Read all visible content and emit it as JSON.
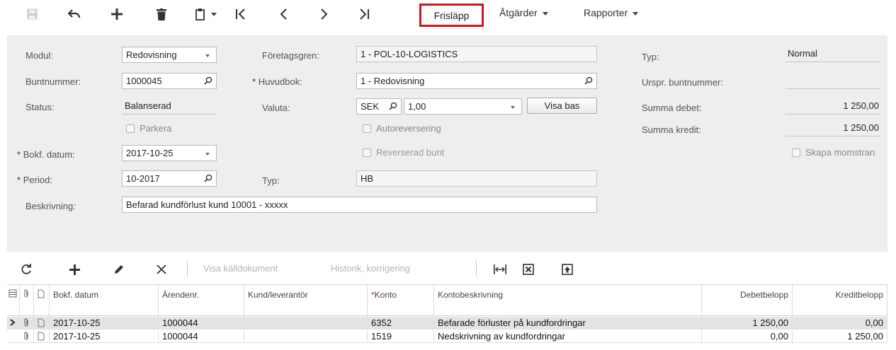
{
  "toolbar": {
    "icons": [
      "save-icon",
      "undo-icon",
      "add-icon",
      "delete-icon",
      "copy-paste-icon",
      "first-record-icon",
      "previous-record-icon",
      "next-record-icon",
      "last-record-icon"
    ],
    "release_label": "Frisläpp",
    "actions_label": "Åtgärder",
    "reports_label": "Rapporter"
  },
  "form": {
    "module": {
      "label": "Modul:",
      "value": "Redovisning"
    },
    "batch_number": {
      "label": "Buntnummer:",
      "value": "1000045"
    },
    "status": {
      "label": "Status:",
      "value": "Balanserad"
    },
    "hold": {
      "label": "Parkera",
      "checked": false
    },
    "posting_date": {
      "required": "*",
      "label": "Bokf. datum:",
      "value": "2017-10-25"
    },
    "period": {
      "required": "*",
      "label": "Period:",
      "value": "10-2017"
    },
    "description": {
      "label": "Beskrivning:",
      "value": "Befarad kundförlust kund 10001 - xxxxx"
    },
    "branch": {
      "label": "Företagsgren:",
      "value": "1 - POL-10-LOGISTICS"
    },
    "ledger": {
      "required": "*",
      "label": "Huvudbok:",
      "value": "1 - Redovisning"
    },
    "currency": {
      "label": "Valuta:",
      "value": "SEK",
      "rate": "1,00",
      "view_base_label": "Visa bas"
    },
    "auto_reversing": {
      "label": "Autoreversering",
      "checked": false
    },
    "reversing_batch": {
      "label": "Reverserad bunt",
      "checked": false
    },
    "journal_type": {
      "label": "Typ:",
      "value": "HB"
    },
    "type": {
      "label": "Typ:",
      "value": "Normal"
    },
    "orig_batch_number": {
      "label": "Urspr. buntnummer:",
      "value": ""
    },
    "debit_total": {
      "label": "Summa debet:",
      "value": "1 250,00"
    },
    "credit_total": {
      "label": "Summa kredit:",
      "value": "1 250,00"
    },
    "create_vat": {
      "label": "Skapa momstran",
      "checked": false
    }
  },
  "grid_toolbar": {
    "icons": [
      "refresh-icon",
      "add-row-icon",
      "edit-icon",
      "delete-row-icon",
      "fit-columns-icon",
      "export-excel-icon",
      "upload-icon"
    ],
    "view_source_label": "Visa källdokument",
    "history_label": "Historik, korrigering"
  },
  "grid": {
    "columns": [
      "Bokf. datum",
      "Ärendenr.",
      "Kund/leverantör",
      "Konto",
      "Kontobeskrivning",
      "Debetbelopp",
      "Kreditbelopp"
    ],
    "required_marker": "*",
    "rows": [
      {
        "date": "2017-10-25",
        "ref": "1000044",
        "customer": "",
        "account": "6352",
        "account_desc": "Befarade förluster på kundfordringar",
        "debit": "1 250,00",
        "credit": "0,00",
        "selected": true
      },
      {
        "date": "2017-10-25",
        "ref": "1000044",
        "customer": "",
        "account": "1519",
        "account_desc": "Nedskrivning av kundfordringar",
        "debit": "0,00",
        "credit": "1 250,00",
        "selected": false
      }
    ]
  },
  "colors": {
    "highlight": "#d4141c",
    "panel": "#eceeef",
    "selected_row": "#e4e4e4"
  }
}
